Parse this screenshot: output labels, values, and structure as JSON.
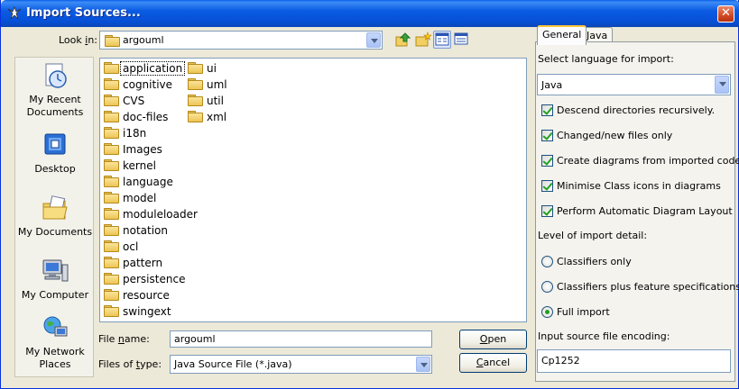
{
  "window": {
    "title": "Import Sources..."
  },
  "lookin": {
    "label_pre": "Look ",
    "label_u": "i",
    "label_post": "n:",
    "value": "argouml"
  },
  "places": [
    {
      "name": "place-recent",
      "label": "My Recent Documents",
      "icon": "recent-documents-icon"
    },
    {
      "name": "place-desktop",
      "label": "Desktop",
      "icon": "desktop-icon"
    },
    {
      "name": "place-documents",
      "label": "My Documents",
      "icon": "my-documents-icon"
    },
    {
      "name": "place-computer",
      "label": "My Computer",
      "icon": "my-computer-icon"
    },
    {
      "name": "place-network",
      "label": "My Network Places",
      "icon": "network-places-icon"
    }
  ],
  "files": {
    "col1": [
      "application",
      "cognitive",
      "CVS",
      "doc-files",
      "i18n",
      "Images",
      "kernel",
      "language",
      "model",
      "moduleloader",
      "notation",
      "ocl",
      "pattern",
      "persistence",
      "resource",
      "swingext"
    ],
    "col2": [
      "ui",
      "uml",
      "util",
      "xml"
    ],
    "selected": "application"
  },
  "filename": {
    "label_pre": "File ",
    "label_u": "n",
    "label_post": "ame:",
    "value": "argouml"
  },
  "filetype": {
    "label_pre": "Files of ",
    "label_u": "t",
    "label_post": "ype:",
    "value": "Java Source File (*.java)"
  },
  "buttons": {
    "open_pre": "",
    "open_u": "O",
    "open_post": "pen",
    "cancel_pre": "",
    "cancel_u": "C",
    "cancel_post": "ancel"
  },
  "tabs": [
    "General",
    "Java"
  ],
  "general": {
    "language_label": "Select language for import:",
    "language_value": "Java",
    "checkboxes": [
      "Descend directories recursively.",
      "Changed/new files only",
      "Create diagrams from imported code",
      "Minimise Class icons in diagrams",
      "Perform Automatic Diagram Layout"
    ],
    "detail_label": "Level of import detail:",
    "radios": [
      "Classifiers only",
      "Classifiers plus feature specifications",
      "Full import"
    ],
    "selected_radio": "Full import",
    "encoding_label": "Input source file encoding:",
    "encoding_value": "Cp1252"
  },
  "colors": {
    "title_blue": "#0a5fe8",
    "dialog_bg": "#ece9d8",
    "check_green": "#21a121"
  }
}
